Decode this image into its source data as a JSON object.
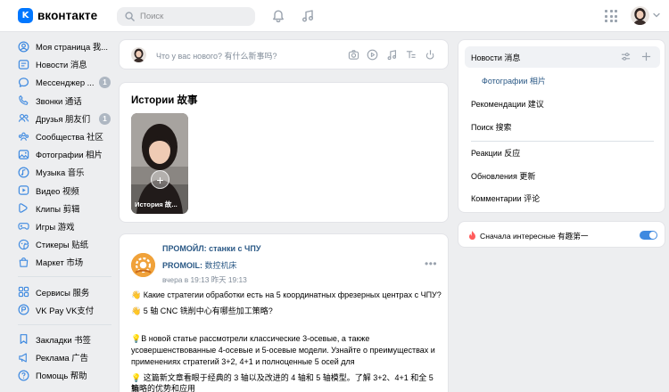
{
  "header": {
    "logo_letter": "K",
    "logo_text": "вконтакте",
    "search_placeholder": "Поиск",
    "accent": "#0077ff"
  },
  "sidebar": {
    "items": [
      {
        "label": "Моя страница 我...",
        "icon": "user-circle-icon"
      },
      {
        "label": "Новости 消息",
        "icon": "newspaper-icon"
      },
      {
        "label": "Мессенджер ...",
        "icon": "chat-bubble-icon",
        "badge": "1"
      },
      {
        "label": "Звонки 通话",
        "icon": "phone-icon"
      },
      {
        "label": "Друзья 朋友们",
        "icon": "friends-icon",
        "badge": "1"
      },
      {
        "label": "Сообщества 社区",
        "icon": "communities-icon"
      },
      {
        "label": "Фотографии 相片",
        "icon": "photo-icon"
      },
      {
        "label": "Музыка 音乐",
        "icon": "music-icon"
      },
      {
        "label": "Видео 视频",
        "icon": "video-icon"
      },
      {
        "label": "Клипы 剪辑",
        "icon": "clips-icon"
      },
      {
        "label": "Игры 游戏",
        "icon": "gamepad-icon"
      },
      {
        "label": "Стикеры 贴纸",
        "icon": "sticker-icon"
      },
      {
        "label": "Маркет 市场",
        "icon": "market-bag-icon"
      }
    ],
    "items2": [
      {
        "label": "Сервисы 服务",
        "icon": "services-icon"
      },
      {
        "label": "VK Pay VK支付",
        "icon": "vkpay-icon"
      }
    ],
    "items3": [
      {
        "label": "Закладки 书签",
        "icon": "bookmark-icon"
      },
      {
        "label": "Реклама 广告",
        "icon": "ads-icon"
      },
      {
        "label": "Помощь 帮助",
        "icon": "help-icon"
      }
    ]
  },
  "composer": {
    "placeholder": "Что у вас нового? 有什么新事吗?"
  },
  "stories": {
    "title": "Истории 故事",
    "story_label": "История 故..."
  },
  "post": {
    "author": "ПРОМОЙЛ: станки с ЧПУ",
    "author_cn_bold": "PROMOIL:",
    "author_cn_plain": " 数控机床",
    "time": "вчера в 19:13 昨天 19:13",
    "lines": [
      "👋 Какие стратегии обработки есть на 5 координатных фрезерных центрах с ЧПУ?",
      "👋 5 轴 CNC 铣削中心有哪些加工策略?",
      "💡В новой статье рассмотрели классические 3-осевые, а также",
      "усовершенствованные 4-осевые и 5-осевые модели. Узнайте о преимуществах и",
      "применениях стратегий 3+2, 4+1 и полноценные 5 осей для",
      "💡 这篇新文章看眼于经典的 3 轴以及改进的 4 轴和 5 轴模型。了解 3+2、4+1 和全 5 轴",
      "策略的优势和应用"
    ]
  },
  "right_nav": {
    "items": [
      {
        "label": "Новости 消息",
        "active": true
      },
      {
        "label": "Фотографии 相片",
        "sub": true
      },
      {
        "label": "Рекомендации 建议"
      },
      {
        "label": "Поиск 搜索"
      },
      {
        "label": "Реакции 反应"
      },
      {
        "label": "Обновления 更新"
      },
      {
        "label": "Комментарии 评论"
      }
    ]
  },
  "interest": {
    "label": "Сначала интересные 有趣第一",
    "enabled": true,
    "toggle_color": "#3f8ae0"
  }
}
